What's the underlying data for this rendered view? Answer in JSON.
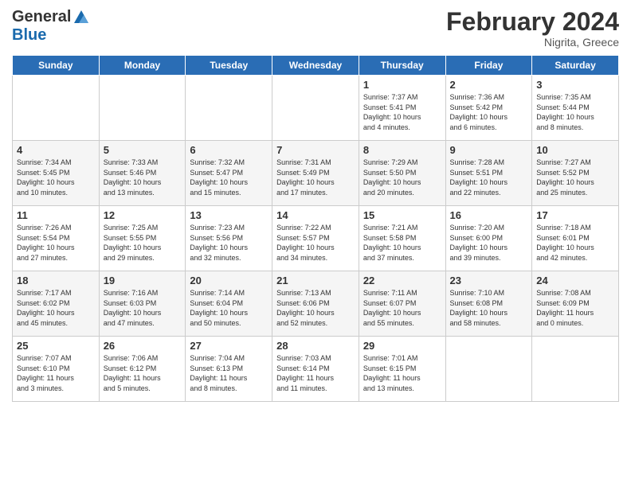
{
  "app": {
    "logo": {
      "general": "General",
      "blue": "Blue",
      "tagline": ""
    }
  },
  "header": {
    "month_year": "February 2024",
    "location": "Nigrita, Greece"
  },
  "weekdays": [
    "Sunday",
    "Monday",
    "Tuesday",
    "Wednesday",
    "Thursday",
    "Friday",
    "Saturday"
  ],
  "weeks": [
    [
      {
        "day": "",
        "info": ""
      },
      {
        "day": "",
        "info": ""
      },
      {
        "day": "",
        "info": ""
      },
      {
        "day": "",
        "info": ""
      },
      {
        "day": "1",
        "info": "Sunrise: 7:37 AM\nSunset: 5:41 PM\nDaylight: 10 hours\nand 4 minutes."
      },
      {
        "day": "2",
        "info": "Sunrise: 7:36 AM\nSunset: 5:42 PM\nDaylight: 10 hours\nand 6 minutes."
      },
      {
        "day": "3",
        "info": "Sunrise: 7:35 AM\nSunset: 5:44 PM\nDaylight: 10 hours\nand 8 minutes."
      }
    ],
    [
      {
        "day": "4",
        "info": "Sunrise: 7:34 AM\nSunset: 5:45 PM\nDaylight: 10 hours\nand 10 minutes."
      },
      {
        "day": "5",
        "info": "Sunrise: 7:33 AM\nSunset: 5:46 PM\nDaylight: 10 hours\nand 13 minutes."
      },
      {
        "day": "6",
        "info": "Sunrise: 7:32 AM\nSunset: 5:47 PM\nDaylight: 10 hours\nand 15 minutes."
      },
      {
        "day": "7",
        "info": "Sunrise: 7:31 AM\nSunset: 5:49 PM\nDaylight: 10 hours\nand 17 minutes."
      },
      {
        "day": "8",
        "info": "Sunrise: 7:29 AM\nSunset: 5:50 PM\nDaylight: 10 hours\nand 20 minutes."
      },
      {
        "day": "9",
        "info": "Sunrise: 7:28 AM\nSunset: 5:51 PM\nDaylight: 10 hours\nand 22 minutes."
      },
      {
        "day": "10",
        "info": "Sunrise: 7:27 AM\nSunset: 5:52 PM\nDaylight: 10 hours\nand 25 minutes."
      }
    ],
    [
      {
        "day": "11",
        "info": "Sunrise: 7:26 AM\nSunset: 5:54 PM\nDaylight: 10 hours\nand 27 minutes."
      },
      {
        "day": "12",
        "info": "Sunrise: 7:25 AM\nSunset: 5:55 PM\nDaylight: 10 hours\nand 29 minutes."
      },
      {
        "day": "13",
        "info": "Sunrise: 7:23 AM\nSunset: 5:56 PM\nDaylight: 10 hours\nand 32 minutes."
      },
      {
        "day": "14",
        "info": "Sunrise: 7:22 AM\nSunset: 5:57 PM\nDaylight: 10 hours\nand 34 minutes."
      },
      {
        "day": "15",
        "info": "Sunrise: 7:21 AM\nSunset: 5:58 PM\nDaylight: 10 hours\nand 37 minutes."
      },
      {
        "day": "16",
        "info": "Sunrise: 7:20 AM\nSunset: 6:00 PM\nDaylight: 10 hours\nand 39 minutes."
      },
      {
        "day": "17",
        "info": "Sunrise: 7:18 AM\nSunset: 6:01 PM\nDaylight: 10 hours\nand 42 minutes."
      }
    ],
    [
      {
        "day": "18",
        "info": "Sunrise: 7:17 AM\nSunset: 6:02 PM\nDaylight: 10 hours\nand 45 minutes."
      },
      {
        "day": "19",
        "info": "Sunrise: 7:16 AM\nSunset: 6:03 PM\nDaylight: 10 hours\nand 47 minutes."
      },
      {
        "day": "20",
        "info": "Sunrise: 7:14 AM\nSunset: 6:04 PM\nDaylight: 10 hours\nand 50 minutes."
      },
      {
        "day": "21",
        "info": "Sunrise: 7:13 AM\nSunset: 6:06 PM\nDaylight: 10 hours\nand 52 minutes."
      },
      {
        "day": "22",
        "info": "Sunrise: 7:11 AM\nSunset: 6:07 PM\nDaylight: 10 hours\nand 55 minutes."
      },
      {
        "day": "23",
        "info": "Sunrise: 7:10 AM\nSunset: 6:08 PM\nDaylight: 10 hours\nand 58 minutes."
      },
      {
        "day": "24",
        "info": "Sunrise: 7:08 AM\nSunset: 6:09 PM\nDaylight: 11 hours\nand 0 minutes."
      }
    ],
    [
      {
        "day": "25",
        "info": "Sunrise: 7:07 AM\nSunset: 6:10 PM\nDaylight: 11 hours\nand 3 minutes."
      },
      {
        "day": "26",
        "info": "Sunrise: 7:06 AM\nSunset: 6:12 PM\nDaylight: 11 hours\nand 5 minutes."
      },
      {
        "day": "27",
        "info": "Sunrise: 7:04 AM\nSunset: 6:13 PM\nDaylight: 11 hours\nand 8 minutes."
      },
      {
        "day": "28",
        "info": "Sunrise: 7:03 AM\nSunset: 6:14 PM\nDaylight: 11 hours\nand 11 minutes."
      },
      {
        "day": "29",
        "info": "Sunrise: 7:01 AM\nSunset: 6:15 PM\nDaylight: 11 hours\nand 13 minutes."
      },
      {
        "day": "",
        "info": ""
      },
      {
        "day": "",
        "info": ""
      }
    ]
  ]
}
